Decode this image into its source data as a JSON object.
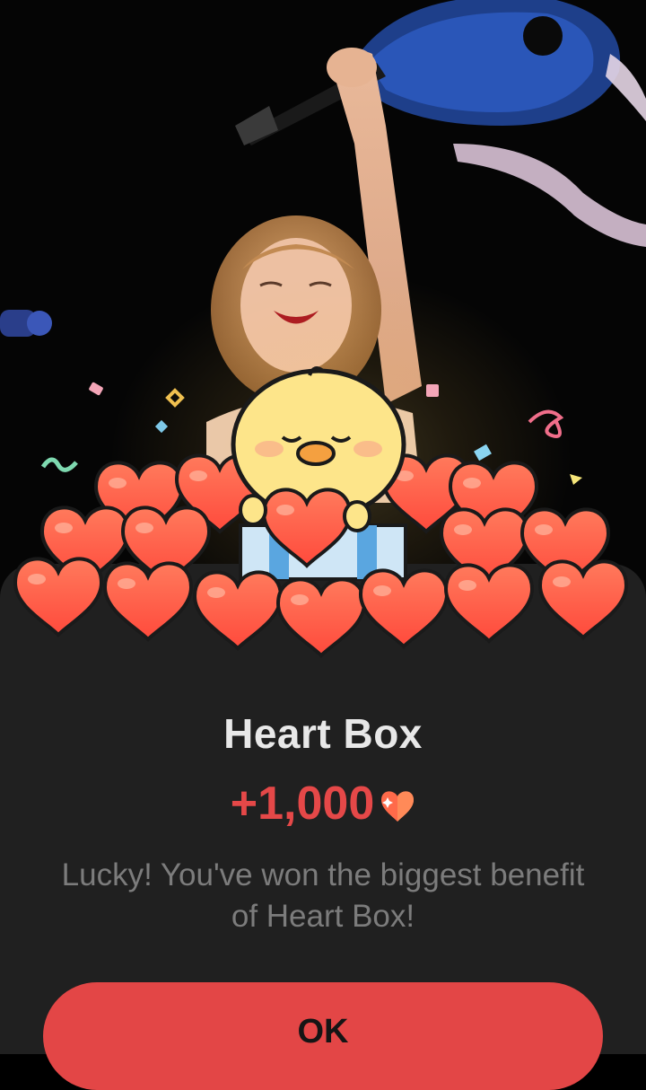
{
  "dialog": {
    "title": "Heart Box",
    "reward_amount": "+1,000",
    "reward_icon": "heart-icon",
    "message": "Lucky! You've won the biggest benefit of Heart Box!",
    "ok_label": "OK"
  },
  "colors": {
    "accent": "#e34646",
    "sheet_background": "#202020",
    "title_text": "#e8e8e8",
    "message_text": "#7c7c7c"
  }
}
